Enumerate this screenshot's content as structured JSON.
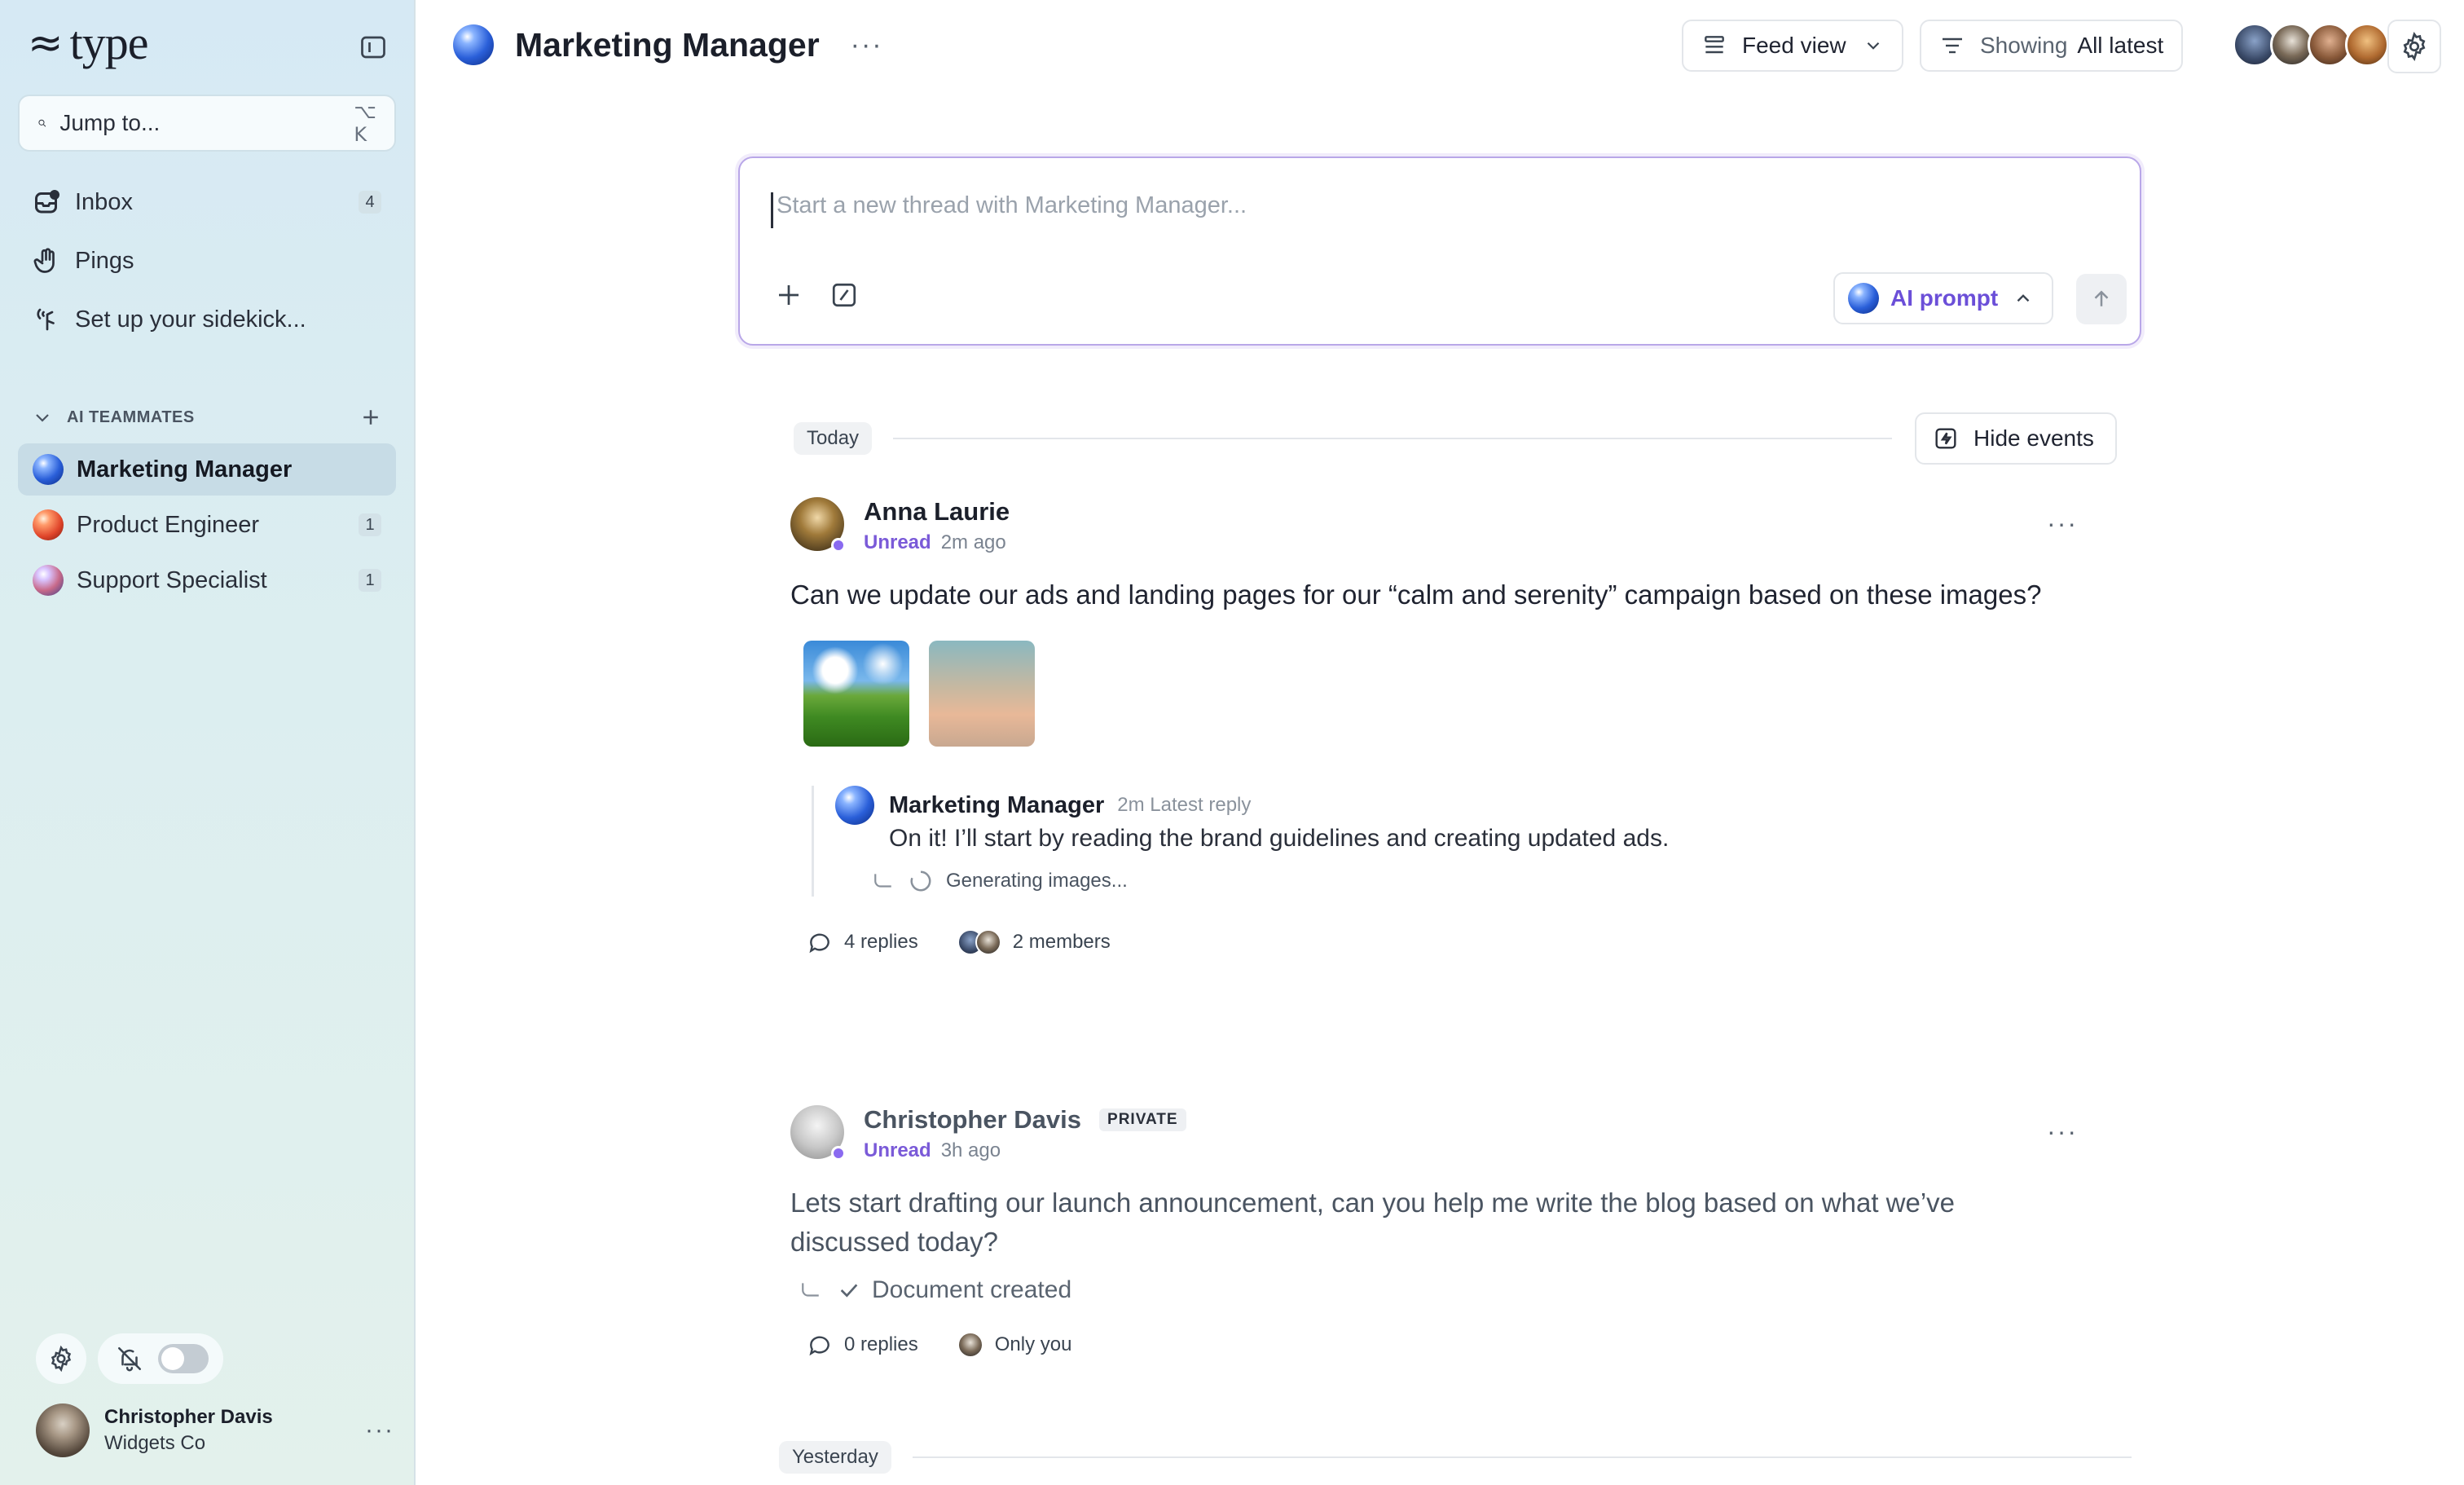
{
  "sidebar": {
    "logo": "type",
    "jump": {
      "placeholder": "Jump to...",
      "shortcut": "⌥ K"
    },
    "nav": [
      {
        "label": "Inbox",
        "icon": "inbox-icon",
        "badge": "4"
      },
      {
        "label": "Pings",
        "icon": "wave-hand-icon",
        "badge": ""
      },
      {
        "label": "Set up your sidekick...",
        "icon": "sidekick-icon",
        "badge": ""
      }
    ],
    "section_title": "AI TEAMMATES",
    "teammates": [
      {
        "label": "Marketing Manager",
        "badge": "",
        "active": true
      },
      {
        "label": "Product Engineer",
        "badge": "1",
        "active": false
      },
      {
        "label": "Support Specialist",
        "badge": "1",
        "active": false
      }
    ],
    "user": {
      "name": "Christopher Davis",
      "org": "Widgets Co"
    }
  },
  "header": {
    "title": "Marketing Manager",
    "feed_view": "Feed view",
    "showing_label": "Showing",
    "showing_value": "All latest"
  },
  "composer": {
    "placeholder": "Start a new thread with Marketing Manager...",
    "ai_prompt": "AI prompt"
  },
  "feed": {
    "today": "Today",
    "yesterday": "Yesterday",
    "hide_events": "Hide events",
    "posts": [
      {
        "author": "Anna Laurie",
        "status": "Unread",
        "time": "2m ago",
        "text": "Can we update our ads and landing pages for our “calm and serenity” campaign based on these images?",
        "reply": {
          "author": "Marketing Manager",
          "meta": "2m  Latest reply",
          "text": "On it! I’ll start by reading the brand guidelines and creating updated ads.",
          "event": "Generating images..."
        },
        "replies": "4 replies",
        "members": "2 members"
      },
      {
        "author": "Christopher Davis",
        "tag": "PRIVATE",
        "status": "Unread",
        "time": "3h ago",
        "text": "Lets start drafting our launch announcement, can you help me write the blog based on what we’ve discussed today?",
        "event": "Document created",
        "replies": "0 replies",
        "members": "Only you"
      }
    ]
  },
  "colors": {
    "accent": "#7a5ad8",
    "sidebar_bg": "#d6e9f4"
  }
}
